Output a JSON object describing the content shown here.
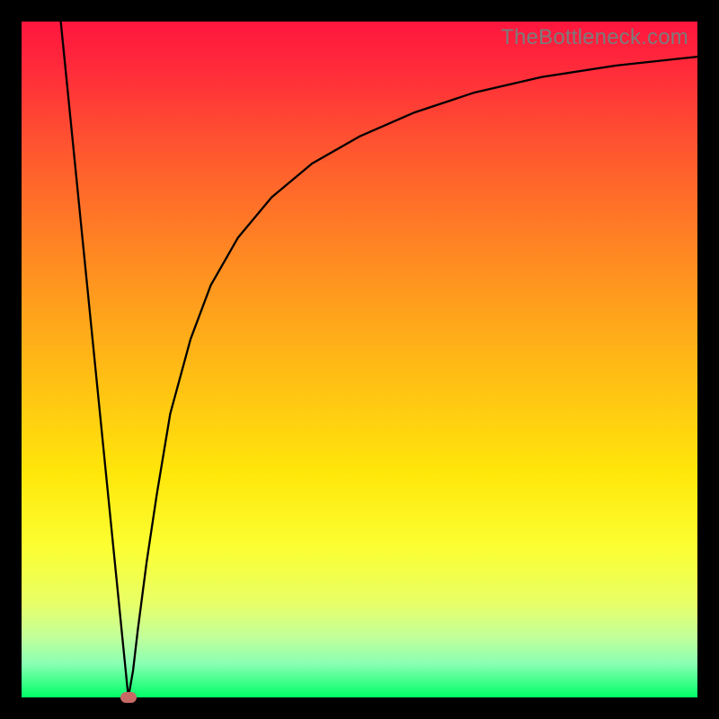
{
  "watermark": "TheBottleneck.com",
  "chart_data": {
    "type": "line",
    "title": "",
    "xlabel": "",
    "ylabel": "",
    "xlim": [
      0,
      100
    ],
    "ylim": [
      0,
      100
    ],
    "grid": false,
    "series": [
      {
        "name": "curve",
        "x": [
          5.8,
          15.8,
          16.5,
          17.2,
          18.5,
          20.0,
          22.0,
          25.0,
          28.0,
          32.0,
          37.0,
          43.0,
          50.0,
          58.0,
          67.0,
          77.0,
          88.0,
          100.0
        ],
        "y": [
          100,
          0,
          4,
          10,
          20,
          30,
          42,
          53,
          61,
          68,
          74,
          79,
          83,
          86.5,
          89.5,
          91.8,
          93.5,
          94.8
        ]
      }
    ],
    "marker": {
      "x": 15.8,
      "y": 0
    },
    "background_gradient": {
      "top_color": "#ff163e",
      "bottom_color": "#00ff66"
    }
  }
}
